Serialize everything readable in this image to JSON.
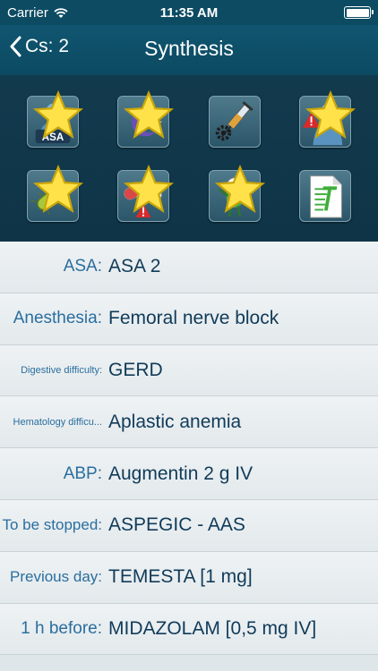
{
  "status_bar": {
    "carrier": "Carrier",
    "time": "11:35 AM",
    "battery_level": 1.0
  },
  "nav": {
    "back_label": "Cs: 2",
    "title": "Synthesis"
  },
  "grid": {
    "tiles": [
      {
        "name": "asa-tile",
        "icon": "asa-body-icon",
        "text": "ASA",
        "starred": true
      },
      {
        "name": "night-tile",
        "icon": "moon-stars-icon",
        "starred": true
      },
      {
        "name": "anesthesia-tile",
        "icon": "syringe-gear-icon",
        "starred": false
      },
      {
        "name": "risk-tile",
        "icon": "body-warning-icon",
        "starred": true
      },
      {
        "name": "bacteria-tile",
        "icon": "bacteria-icon",
        "starred": true
      },
      {
        "name": "drug-allergy-tile",
        "icon": "pills-warning-icon",
        "starred": true
      },
      {
        "name": "premedication-tile",
        "icon": "pill-character-icon",
        "starred": true
      },
      {
        "name": "document-tile",
        "icon": "document-t-icon",
        "starred": false
      }
    ]
  },
  "rows": [
    {
      "label": "ASA:",
      "value": "ASA 2",
      "size": "lg"
    },
    {
      "label": "Anesthesia:",
      "value": "Femoral nerve block",
      "size": "lg"
    },
    {
      "label": "Digestive difficulty:",
      "value": "GERD",
      "size": "xs"
    },
    {
      "label": "Hematology difficu...",
      "value": "Aplastic anemia",
      "size": "xs"
    },
    {
      "label": "ABP:",
      "value": "Augmentin 2 g IV",
      "size": "lg"
    },
    {
      "label": "To be stopped:",
      "value": "ASPEGIC  -  AAS",
      "size": "md"
    },
    {
      "label": "Previous day:",
      "value": "TEMESTA  [1 mg]",
      "size": "md"
    },
    {
      "label": "1 h before:",
      "value": "MIDAZOLAM  [0,5 mg IV]",
      "size": "lg"
    }
  ]
}
